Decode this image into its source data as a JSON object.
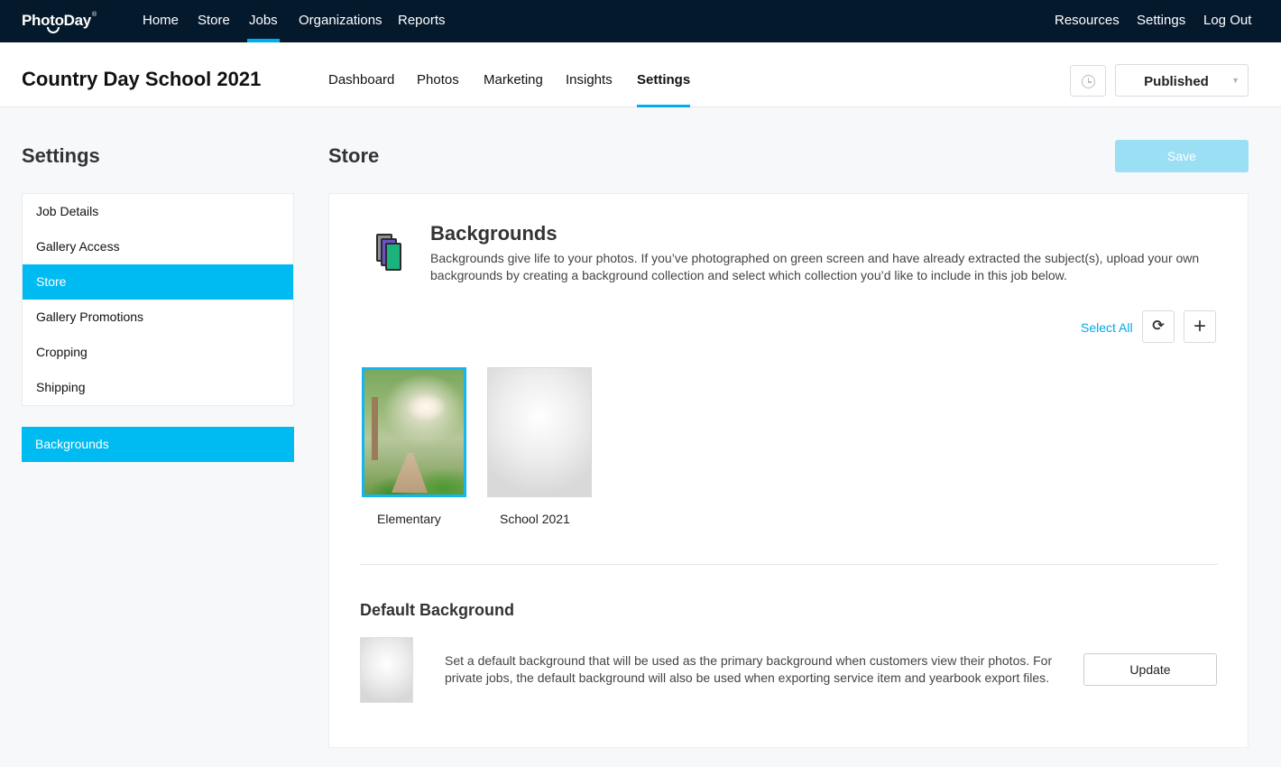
{
  "topnav": {
    "logo": "PhotoDay",
    "logo_tm": "®",
    "items": [
      "Home",
      "Store",
      "Jobs",
      "Organizations",
      "Reports"
    ],
    "right_items": [
      "Resources",
      "Settings",
      "Log Out"
    ],
    "active": "Jobs"
  },
  "job": {
    "title": "Country Day School 2021",
    "tabs": [
      "Dashboard",
      "Photos",
      "Marketing",
      "Insights",
      "Settings"
    ],
    "active_tab": "Settings",
    "status": "Published"
  },
  "sidebar": {
    "heading": "Settings",
    "items": [
      "Job Details",
      "Gallery Access",
      "Store",
      "Gallery Promotions",
      "Cropping",
      "Shipping"
    ],
    "active": "Store",
    "sub_item": "Backgrounds"
  },
  "main": {
    "heading": "Store",
    "save_label": "Save",
    "backgrounds": {
      "title": "Backgrounds",
      "description": "Backgrounds give life to your photos. If you’ve photographed on green screen and have already extracted the subject(s), upload your own backgrounds by creating a background collection and select which collection you’d like to include in this job below.",
      "select_all": "Select All",
      "refresh_icon": "refresh-icon",
      "add_icon": "plus-icon",
      "collections": [
        {
          "name": "Elementary",
          "selected": true
        },
        {
          "name": "School 2021",
          "selected": false
        }
      ]
    },
    "default_background": {
      "title": "Default Background",
      "description": "Set a default background that will be used as the primary background when customers view their photos. For private jobs, the default background will also be used when exporting service item and yearbook export files.",
      "update_label": "Update"
    }
  },
  "colors": {
    "nav_bg": "#05192d",
    "accent": "#00bbf2",
    "link": "#00a8e8",
    "save_disabled": "#9bdff5"
  }
}
